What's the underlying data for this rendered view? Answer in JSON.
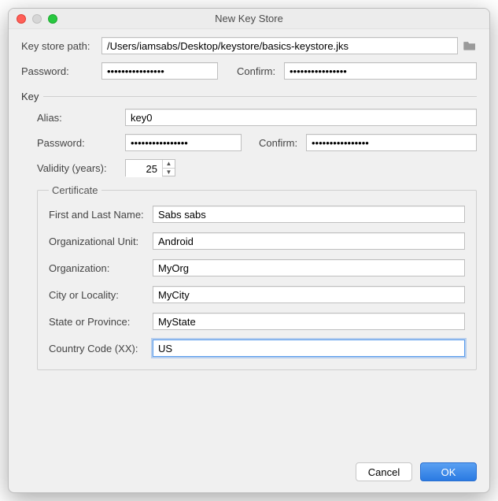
{
  "window": {
    "title": "New Key Store"
  },
  "labels": {
    "keystore_path": "Key store path:",
    "password": "Password:",
    "confirm": "Confirm:",
    "key": "Key",
    "alias": "Alias:",
    "validity": "Validity (years):",
    "certificate": "Certificate",
    "first_last": "First and Last Name:",
    "org_unit": "Organizational Unit:",
    "org": "Organization:",
    "city": "City or Locality:",
    "state": "State or Province:",
    "country": "Country Code (XX):"
  },
  "values": {
    "keystore_path": "/Users/iamsabs/Desktop/keystore/basics-keystore.jks",
    "password": "••••••••••••••••",
    "confirm": "••••••••••••••••",
    "alias": "key0",
    "key_password": "••••••••••••••••",
    "key_confirm": "••••••••••••••••",
    "validity": "25",
    "first_last": "Sabs sabs",
    "org_unit": "Android",
    "org": "MyOrg",
    "city": "MyCity",
    "state": "MyState",
    "country": "US"
  },
  "buttons": {
    "cancel": "Cancel",
    "ok": "OK"
  }
}
